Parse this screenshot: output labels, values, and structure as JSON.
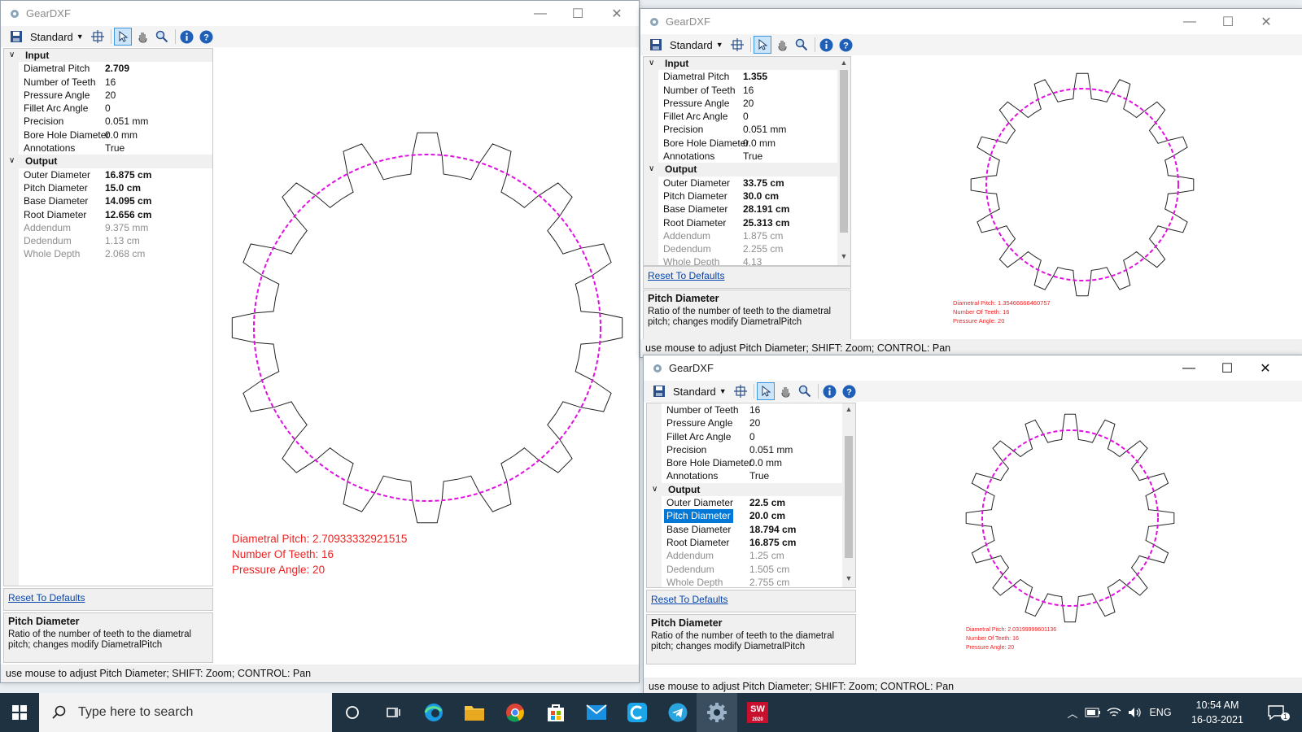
{
  "app_title": "GearDXF",
  "toolbar": {
    "mode": "Standard"
  },
  "window_controls": {
    "minimize": "—",
    "maximize": "☐",
    "close": "✕"
  },
  "windows": [
    {
      "id": "w1",
      "grid_rows": [
        {
          "type": "cat",
          "chev": "∨",
          "label": "Input"
        },
        {
          "label": "Diametral Pitch",
          "value": "2.709",
          "style": "bold"
        },
        {
          "label": "Number of Teeth",
          "value": "16"
        },
        {
          "label": "Pressure Angle",
          "value": "20"
        },
        {
          "label": "Fillet Arc Angle",
          "value": "0"
        },
        {
          "label": "Precision",
          "value": "0.051 mm"
        },
        {
          "label": "Bore Hole Diameter",
          "value": "0.0 mm"
        },
        {
          "label": "Annotations",
          "value": "True"
        },
        {
          "type": "cat",
          "chev": "∨",
          "label": "Output"
        },
        {
          "label": "Outer Diameter",
          "value": "16.875 cm",
          "style": "bold"
        },
        {
          "label": "Pitch Diameter",
          "value": "15.0 cm",
          "style": "bold"
        },
        {
          "label": "Base Diameter",
          "value": "14.095 cm",
          "style": "bold"
        },
        {
          "label": "Root Diameter",
          "value": "12.656 cm",
          "style": "bold"
        },
        {
          "label": "Addendum",
          "value": "9.375 mm",
          "style": "gray"
        },
        {
          "label": "Dedendum",
          "value": "1.13 cm",
          "style": "gray"
        },
        {
          "label": "Whole Depth",
          "value": "2.068 cm",
          "style": "gray"
        }
      ],
      "reset_link": "Reset To Defaults",
      "desc_title": "Pitch Diameter",
      "desc_text": "Ratio of the number of teeth to the diametral pitch; changes modify DiametralPitch",
      "status": "use mouse to adjust Pitch Diameter; SHIFT: Zoom; CONTROL: Pan",
      "annotations": [
        "Diametral Pitch: 2.70933332921515",
        "Number Of Teeth: 16",
        "Pressure Angle: 20"
      ]
    },
    {
      "id": "w2",
      "grid_rows": [
        {
          "type": "cat",
          "chev": "∨",
          "label": "Input"
        },
        {
          "label": "Diametral Pitch",
          "value": "1.355",
          "style": "bold"
        },
        {
          "label": "Number of Teeth",
          "value": "16"
        },
        {
          "label": "Pressure Angle",
          "value": "20"
        },
        {
          "label": "Fillet Arc Angle",
          "value": "0"
        },
        {
          "label": "Precision",
          "value": "0.051 mm"
        },
        {
          "label": "Bore Hole Diameter",
          "value": "0.0 mm"
        },
        {
          "label": "Annotations",
          "value": "True"
        },
        {
          "type": "cat",
          "chev": "∨",
          "label": "Output"
        },
        {
          "label": "Outer Diameter",
          "value": "33.75 cm",
          "style": "bold"
        },
        {
          "label": "Pitch Diameter",
          "value": "30.0 cm",
          "style": "bold"
        },
        {
          "label": "Base Diameter",
          "value": "28.191 cm",
          "style": "bold"
        },
        {
          "label": "Root Diameter",
          "value": "25.313 cm",
          "style": "bold"
        },
        {
          "label": "Addendum",
          "value": "1.875 cm",
          "style": "gray"
        },
        {
          "label": "Dedendum",
          "value": "2.255 cm",
          "style": "gray"
        },
        {
          "label": "Whole Depth",
          "value": "4.13",
          "style": "gray"
        }
      ],
      "reset_link": "Reset To Defaults",
      "desc_title": "Pitch Diameter",
      "desc_text": "Ratio of the number of teeth to the diametral pitch; changes modify DiametralPitch",
      "status": "use mouse to adjust Pitch Diameter; SHIFT: Zoom; CONTROL: Pan",
      "annotations": [
        "Diametral Pitch: 1.35466666460757",
        "Number Of Teeth: 16",
        "Pressure Angle: 20"
      ]
    },
    {
      "id": "w3",
      "grid_rows": [
        {
          "label": "Number of Teeth",
          "value": "16"
        },
        {
          "label": "Pressure Angle",
          "value": "20"
        },
        {
          "label": "Fillet Arc Angle",
          "value": "0"
        },
        {
          "label": "Precision",
          "value": "0.051 mm"
        },
        {
          "label": "Bore Hole Diameter",
          "value": "0.0 mm"
        },
        {
          "label": "Annotations",
          "value": "True"
        },
        {
          "type": "cat",
          "chev": "∨",
          "label": "Output"
        },
        {
          "label": "Outer Diameter",
          "value": "22.5 cm",
          "style": "bold"
        },
        {
          "label": "Pitch Diameter",
          "value": "20.0 cm",
          "style": "bold",
          "selected": true
        },
        {
          "label": "Base Diameter",
          "value": "18.794 cm",
          "style": "bold"
        },
        {
          "label": "Root Diameter",
          "value": "16.875 cm",
          "style": "bold"
        },
        {
          "label": "Addendum",
          "value": "1.25 cm",
          "style": "gray"
        },
        {
          "label": "Dedendum",
          "value": "1.505 cm",
          "style": "gray"
        },
        {
          "label": "Whole Depth",
          "value": "2.755 cm",
          "style": "gray"
        }
      ],
      "reset_link": "Reset To Defaults",
      "desc_title": "Pitch Diameter",
      "desc_text": "Ratio of the number of teeth to the diametral pitch; changes modify DiametralPitch",
      "status": "use mouse to adjust Pitch Diameter; SHIFT: Zoom; CONTROL: Pan",
      "annotations": [
        "Diametral Pitch: 2.03199999601136",
        "Number Of Teeth: 16",
        "Pressure Angle: 20"
      ]
    }
  ],
  "taskbar": {
    "search_placeholder": "Type here to search",
    "language": "ENG",
    "time": "10:54 AM",
    "date": "16-03-2021",
    "notification_count": "1",
    "sw_label": "SW",
    "sw_sub": "2020"
  },
  "colors": {
    "pitch_circle": "#e010e0",
    "annotation": "#ee2222",
    "selection": "#0078d7",
    "taskbar": "#1f3242"
  }
}
